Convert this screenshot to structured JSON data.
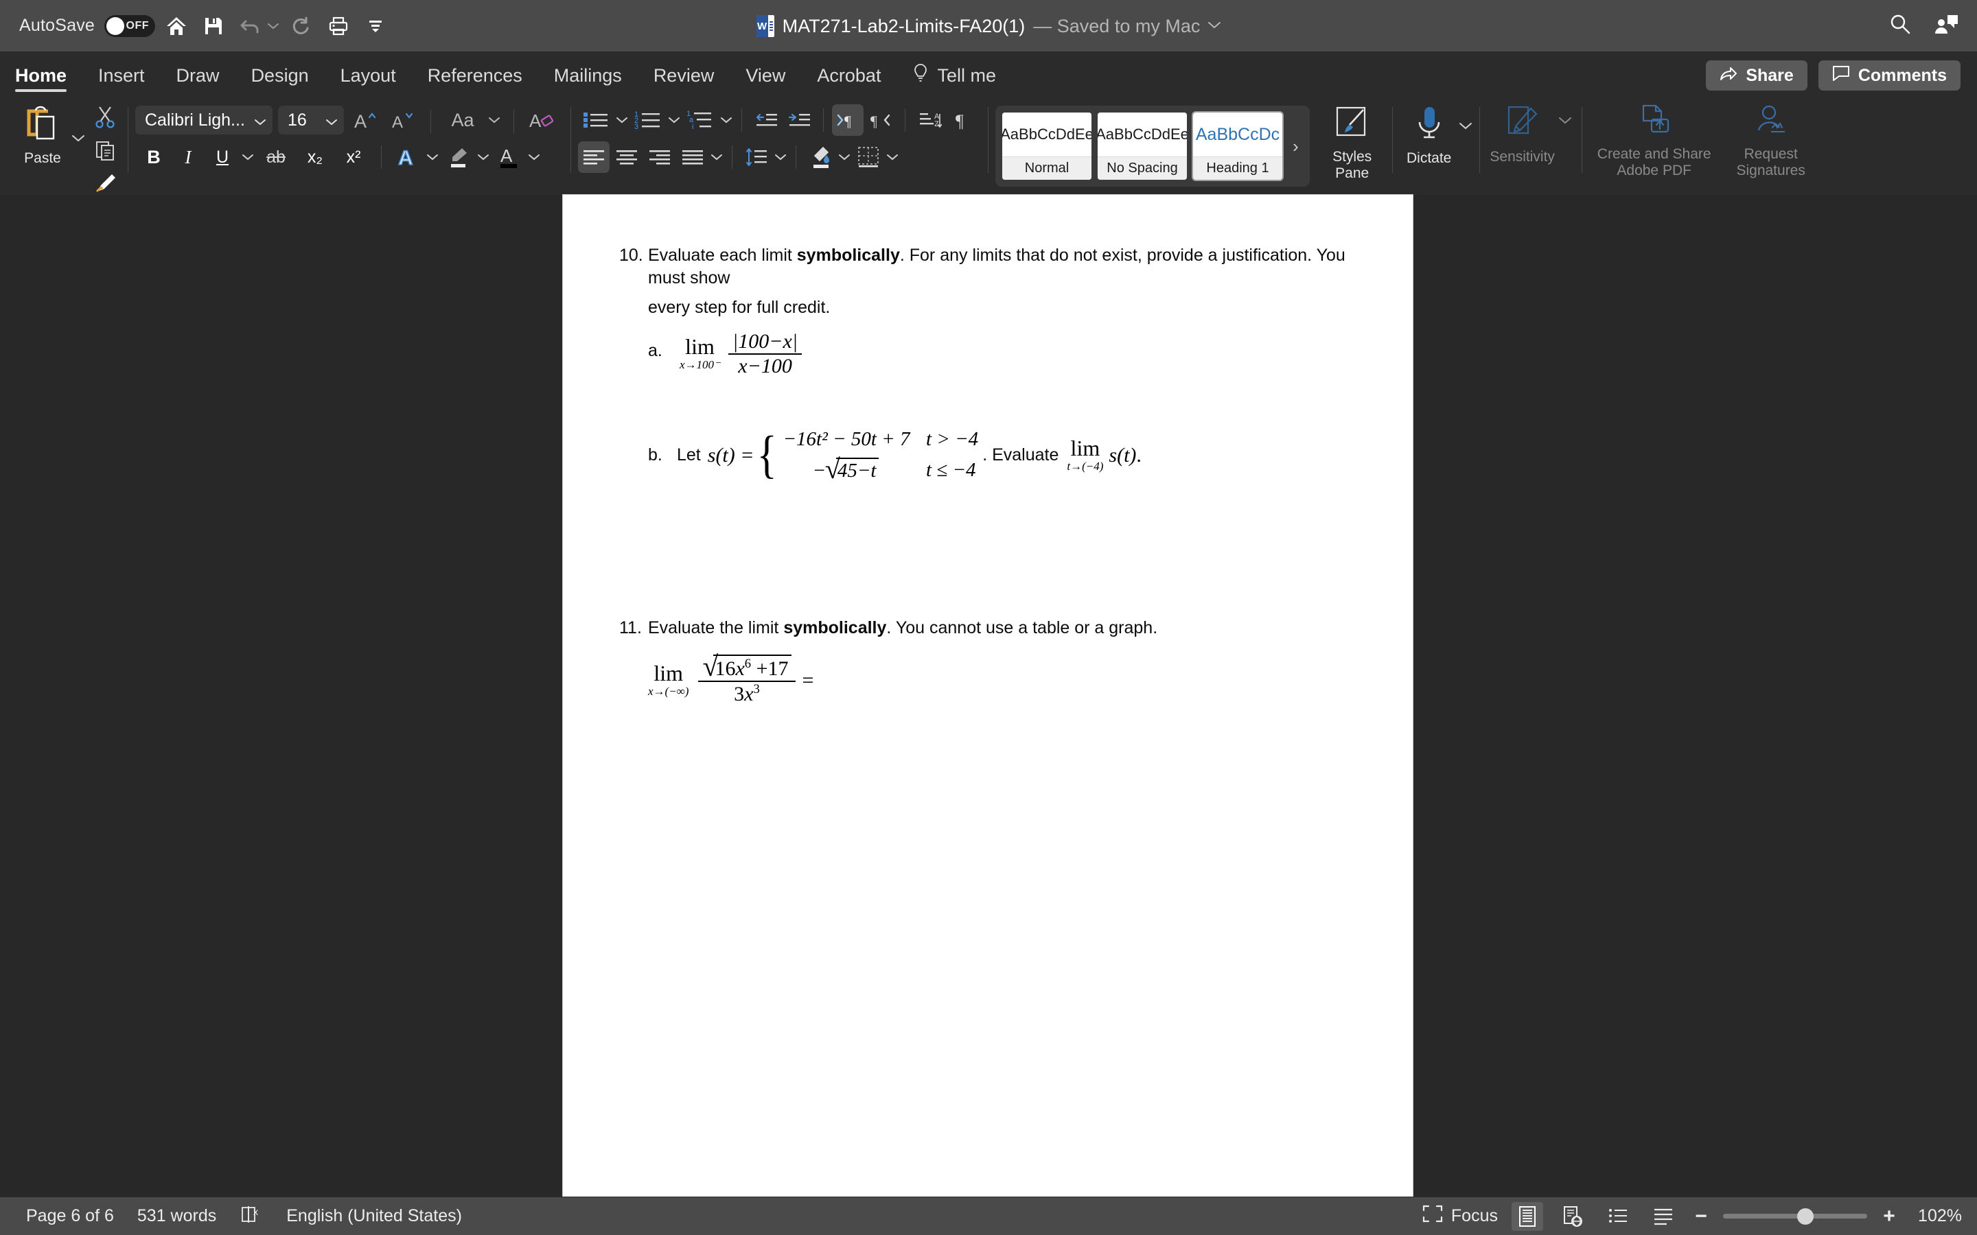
{
  "titlebar": {
    "autosave_label": "AutoSave",
    "autosave_state": "OFF",
    "doc_title": "MAT271-Lab2-Limits-FA20(1)",
    "save_status": "— Saved to my Mac",
    "quick_access": [
      "home-icon",
      "save-icon",
      "undo-icon",
      "redo-icon",
      "print-icon",
      "customize-icon"
    ],
    "right_icons": [
      "search-icon",
      "account-comment-icon"
    ]
  },
  "ribbon": {
    "tabs": [
      {
        "label": "Home",
        "active": true
      },
      {
        "label": "Insert",
        "active": false
      },
      {
        "label": "Draw",
        "active": false
      },
      {
        "label": "Design",
        "active": false
      },
      {
        "label": "Layout",
        "active": false
      },
      {
        "label": "References",
        "active": false
      },
      {
        "label": "Mailings",
        "active": false
      },
      {
        "label": "Review",
        "active": false
      },
      {
        "label": "View",
        "active": false
      },
      {
        "label": "Acrobat",
        "active": false
      }
    ],
    "tell_me": "Tell me",
    "share_label": "Share",
    "comments_label": "Comments",
    "clipboard": {
      "paste_label": "Paste",
      "cut": "cut-icon",
      "copy": "copy-icon",
      "format_painter": "format-painter-icon"
    },
    "font": {
      "family_value": "Calibri Ligh...",
      "size_value": "16",
      "grow_font": "increase-font-size-icon",
      "shrink_font": "decrease-font-size-icon",
      "change_case": "Aa",
      "clear_formatting": "clear-formatting-icon",
      "bold": "B",
      "italic": "I",
      "underline": "U",
      "strikethrough": "ab",
      "subscript": "x₂",
      "superscript": "x²",
      "text_effects": "text-effects-icon",
      "highlight": "text-highlight-icon",
      "font_color": "font-color-icon"
    },
    "paragraph": {
      "bullets": "bullet-list-icon",
      "numbering": "numbered-list-icon",
      "multilevel": "multilevel-list-icon",
      "decrease_indent": "decrease-indent-icon",
      "increase_indent": "increase-indent-icon",
      "ltr": "left-to-right-icon",
      "rtl": "right-to-left-icon",
      "sort": "sort-icon",
      "show_marks": "show-formatting-marks-icon",
      "align_left": "align-left-icon",
      "align_center": "align-center-icon",
      "align_right": "align-right-icon",
      "justify": "justify-icon",
      "line_spacing": "line-spacing-icon",
      "shading": "shading-icon",
      "borders": "borders-icon"
    },
    "styles": {
      "cards": [
        {
          "preview": "AaBbCcDdEe",
          "label": "Normal",
          "selected": false,
          "heading": false
        },
        {
          "preview": "AaBbCcDdEe",
          "label": "No Spacing",
          "selected": false,
          "heading": false
        },
        {
          "preview": "AaBbCcDc",
          "label": "Heading 1",
          "selected": true,
          "heading": true
        }
      ],
      "more": "›",
      "styles_pane_line1": "Styles",
      "styles_pane_line2": "Pane"
    },
    "dictate_label": "Dictate",
    "sensitivity_label": "Sensitivity",
    "adobe_pdf_line1": "Create and Share",
    "adobe_pdf_line2": "Adobe PDF",
    "request_sig_line1": "Request",
    "request_sig_line2": "Signatures"
  },
  "document": {
    "q10": {
      "number": "10.",
      "text_before_bold": "Evaluate each limit ",
      "bold_word": "symbolically",
      "text_after_bold": ". For any limits that do not exist, provide a justification. You must show",
      "line2": "every step for full credit.",
      "part_a": {
        "label": "a.",
        "limit_op": "lim",
        "limit_sub": "x→100⁻",
        "numerator": "|100−x|",
        "denominator": "x−100"
      },
      "part_b": {
        "label": "b.",
        "lead": "Let",
        "function_name": "s(t) =",
        "case1_expr": "−16t² − 50t + 7",
        "case1_cond": "t > −4",
        "case2_expr": "−√45−t",
        "case2_cond": "t ≤ −4",
        "tail": ". Evaluate",
        "limit_op": "lim",
        "limit_sub": "t→(−4)",
        "limit_body": "s(t)",
        "period": "."
      }
    },
    "q11": {
      "number": "11.",
      "text_before_bold": "Evaluate the limit ",
      "bold_word": "symbolically",
      "text_after_bold": ". You cannot use a table or a graph.",
      "expr": {
        "limit_op": "lim",
        "limit_sub": "x→(−∞)",
        "numerator": "√16x⁶ +17",
        "denominator": "3x³",
        "equals": "="
      }
    }
  },
  "statusbar": {
    "page_count": "Page 6 of 6",
    "word_count": "531 words",
    "proofing_icon": "proofing-errors-icon",
    "language": "English (United States)",
    "focus_label": "Focus",
    "view_buttons": [
      "print-layout-icon",
      "web-layout-icon",
      "outline-icon",
      "draft-icon"
    ],
    "zoom_out": "−",
    "zoom_in": "+",
    "zoom_level": "102%"
  },
  "colors": {
    "titlebar_bg": "#4a4a4a",
    "ribbon_bg": "#2b2b2b",
    "doc_bg": "#282828",
    "page_bg": "#ffffff",
    "accent_blue": "#2b579a",
    "heading_blue": "#2e74b5",
    "accent_orange": "#e0a33a"
  }
}
